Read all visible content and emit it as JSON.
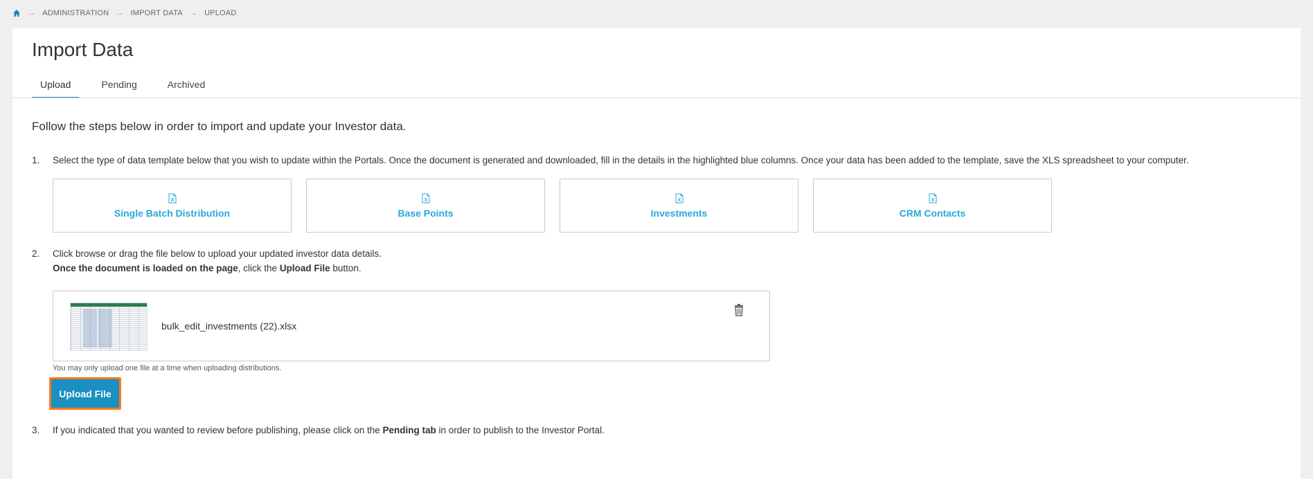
{
  "breadcrumb": {
    "items": [
      "ADMINISTRATION",
      "IMPORT DATA",
      "UPLOAD"
    ]
  },
  "page": {
    "title": "Import Data",
    "tabs": [
      {
        "label": "Upload",
        "active": true
      },
      {
        "label": "Pending",
        "active": false
      },
      {
        "label": "Archived",
        "active": false
      }
    ],
    "intro": "Follow the steps below in order to import and update your Investor data."
  },
  "steps": {
    "s1": {
      "num": "1.",
      "text": "Select the type of data template below that you wish to update within the Portals. Once the document is generated and downloaded, fill in the details in the highlighted blue columns. Once your data has been added to the template, save the XLS spreadsheet to your computer."
    },
    "s2": {
      "num": "2.",
      "line1": "Click browse or drag the file below to upload your updated investor data details.",
      "line2_bold": "Once the document is loaded on the page",
      "line2_mid": ", click the ",
      "line2_bold2": "Upload File",
      "line2_end": " button."
    },
    "s3": {
      "num": "3.",
      "pre": "If you indicated that you wanted to review before publishing, please click on the ",
      "bold": "Pending tab",
      "post": " in order to publish to the Investor Portal."
    }
  },
  "templates": [
    {
      "label": "Single Batch Distribution",
      "icon": "excel-file-icon"
    },
    {
      "label": "Base Points",
      "icon": "excel-file-icon"
    },
    {
      "label": "Investments",
      "icon": "excel-file-icon"
    },
    {
      "label": "CRM Contacts",
      "icon": "excel-file-icon"
    }
  ],
  "upload": {
    "filename": "bulk_edit_investments (22).xlsx",
    "helper": "You may only upload one file at a time when uploading distributions.",
    "button_label": "Upload File"
  },
  "colors": {
    "accent": "#1a8fc2",
    "link": "#27a8d8",
    "highlight": "#ff7a1a"
  }
}
